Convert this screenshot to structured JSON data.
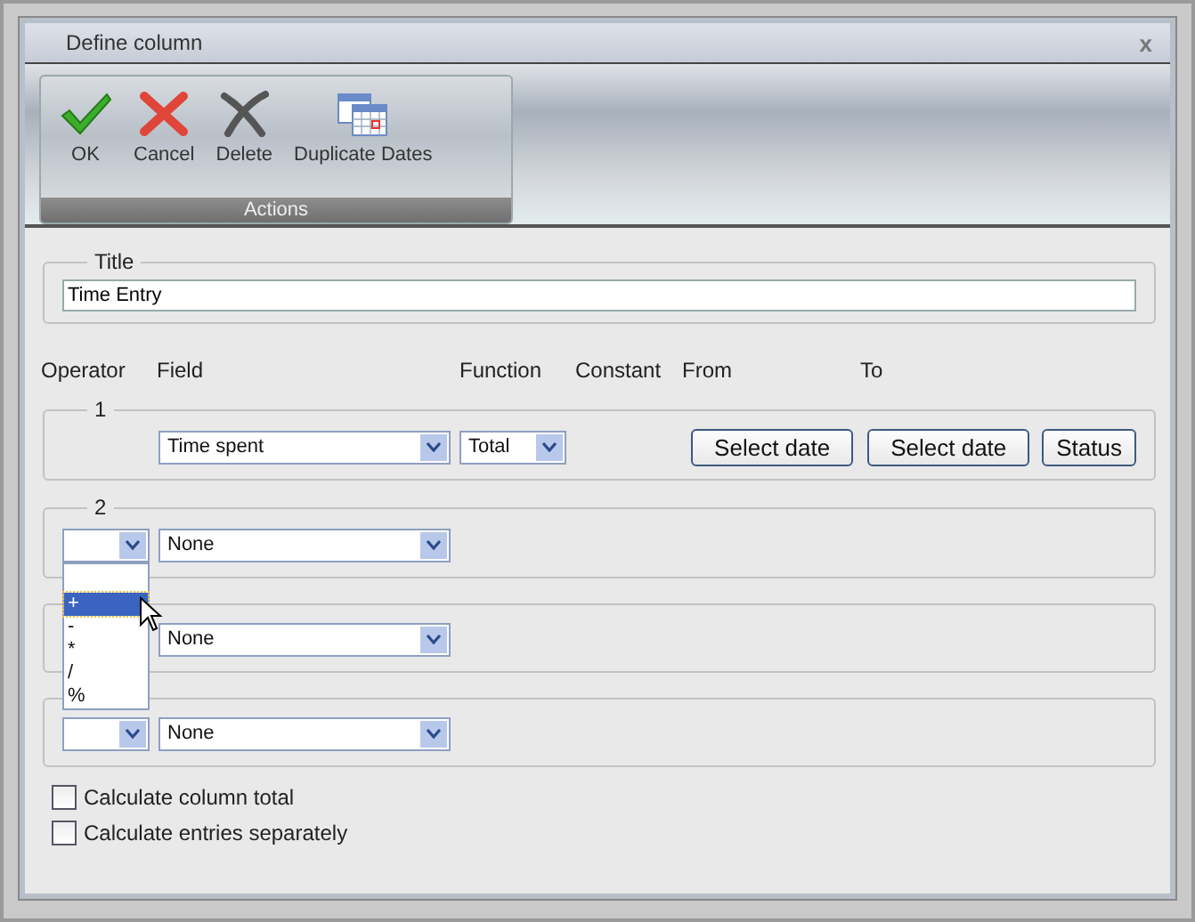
{
  "window": {
    "title": "Define column",
    "close": "x"
  },
  "toolbar": {
    "buttons": [
      {
        "label": "OK",
        "kind": "ok"
      },
      {
        "label": "Cancel",
        "kind": "cancel"
      },
      {
        "label": "Delete",
        "kind": "delete"
      },
      {
        "label": "Duplicate Dates",
        "kind": "calendar"
      }
    ],
    "group_label": "Actions"
  },
  "title_section": {
    "legend": "Title",
    "value": "Time Entry"
  },
  "headers": [
    "Operator",
    "Field",
    "Function",
    "Constant",
    "From",
    "To"
  ],
  "rows": [
    {
      "legend": "1",
      "has_operator": false,
      "field": "Time spent",
      "function": "Total",
      "buttons": [
        "Select date",
        "Select date",
        "Status"
      ]
    },
    {
      "legend": "2",
      "has_operator": true,
      "field": "None",
      "dropdown": {
        "leading_blank": true,
        "options": [
          {
            "label": "+",
            "selected": true
          },
          {
            "label": "-",
            "selected": false
          },
          {
            "label": "*",
            "selected": false
          },
          {
            "label": "/",
            "selected": false
          },
          {
            "label": "%",
            "selected": false
          }
        ]
      }
    },
    {
      "has_operator": false,
      "field": "None"
    },
    {
      "has_operator": true,
      "field": "None"
    }
  ],
  "checkboxes": [
    {
      "label": "Calculate column total",
      "checked": false
    },
    {
      "label": "Calculate entries separately",
      "checked": false
    }
  ]
}
